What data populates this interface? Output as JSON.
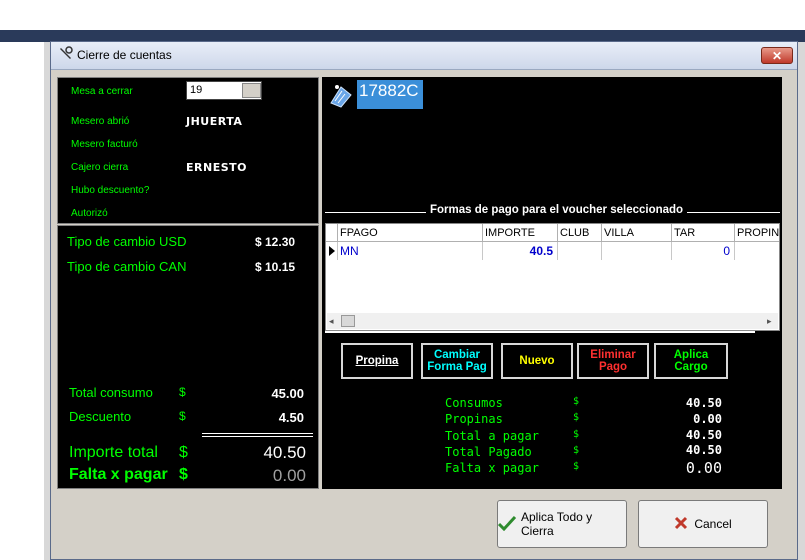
{
  "window": {
    "title": "Cierre de cuentas",
    "close_glyph": "✕"
  },
  "info": {
    "mesa_label": "Mesa a cerrar",
    "mesa_value": "19",
    "mesero_abrio_label": "Mesero abrió",
    "mesero_abrio_value": "JHUERTA",
    "mesero_facturo_label": "Mesero facturó",
    "cajero_label": "Cajero cierra",
    "cajero_value": "ERNESTO",
    "descuento_label": "Hubo descuento?",
    "autorizo_label": "Autorizó"
  },
  "rates": {
    "usd_label": "Tipo de cambio USD",
    "usd_value": "$ 12.30",
    "can_label": "Tipo de cambio CAN",
    "can_value": "$ 10.15"
  },
  "totals": {
    "consumo_label": "Total consumo",
    "consumo_cur": "$",
    "consumo_value": "45.00",
    "descuento_label": "Descuento",
    "descuento_cur": "$",
    "descuento_value": "4.50",
    "importe_label": "Importe total",
    "importe_cur": "$",
    "importe_value": "40.50",
    "falta_label": "Falta x pagar",
    "falta_cur": "$",
    "falta_value": "0.00"
  },
  "voucher": {
    "id": "17882C"
  },
  "payments": {
    "group_title": "Formas de pago para el voucher seleccionado",
    "columns": [
      "FPAGO",
      "IMPORTE",
      "CLUB",
      "VILLA",
      "TAR",
      "PROPINA"
    ],
    "rows": [
      {
        "fpago": "MN",
        "importe": "40.5",
        "club": "",
        "villa": "",
        "tar": "0",
        "propina": ""
      }
    ]
  },
  "actions": {
    "propina": "Propina",
    "cambiar_1": "Cambiar",
    "cambiar_2": "Forma Pag",
    "nuevo": "Nuevo",
    "eliminar_1": "Eliminar",
    "eliminar_2": "Pago",
    "aplica_1": "Aplica",
    "aplica_2": "Cargo"
  },
  "summary": {
    "rows": [
      {
        "label": "Consumos",
        "cur": "$",
        "value": "40.50"
      },
      {
        "label": "Propinas",
        "cur": "$",
        "value": "0.00"
      },
      {
        "label": "Total a pagar",
        "cur": "$",
        "value": "40.50"
      },
      {
        "label": "Total Pagado",
        "cur": "$",
        "value": "40.50"
      },
      {
        "label": "Falta x pagar",
        "cur": "$",
        "value": "0.00"
      }
    ]
  },
  "footer": {
    "apply_label": "Aplica Todo y Cierra",
    "cancel_label": "Cancel"
  },
  "colors": {
    "accent_green": "#00ff00",
    "selected_blue": "#3b8fd9",
    "delete_red": "#ff3030",
    "new_yellow": "#ffff00",
    "change_cyan": "#00ffff"
  },
  "icons": [
    "tools-icon",
    "close-icon",
    "receipt-icon",
    "check-icon",
    "cross-icon"
  ]
}
